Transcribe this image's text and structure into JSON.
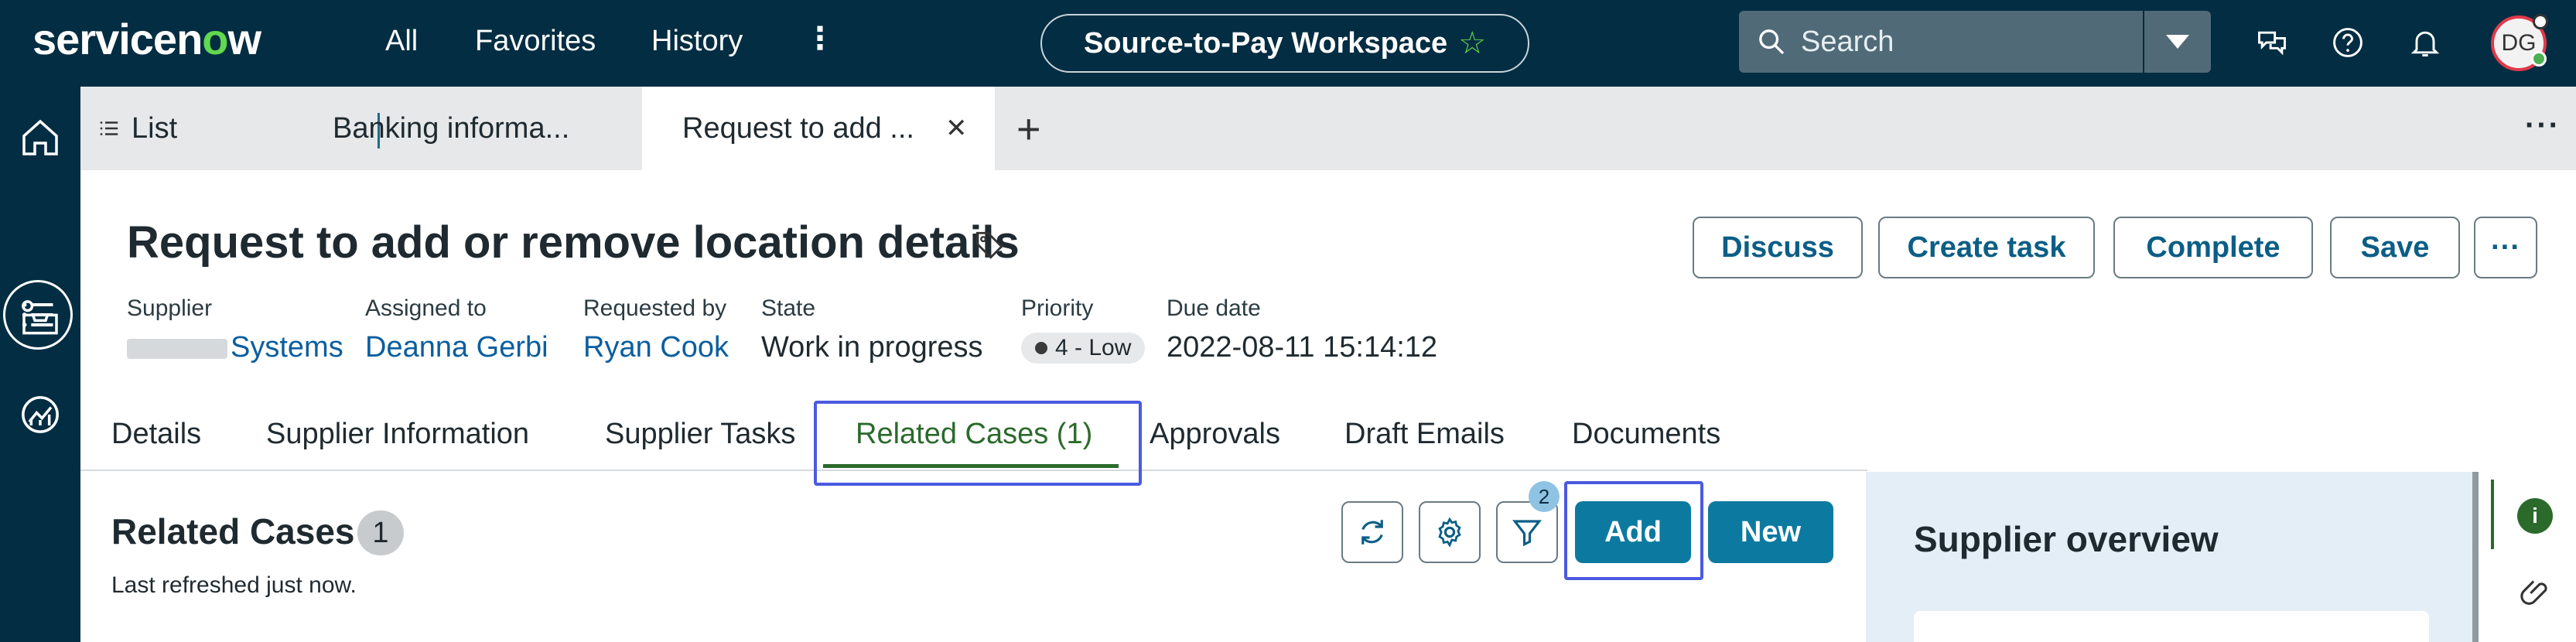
{
  "topbar": {
    "logo": {
      "prefix": "servicen",
      "o": "o",
      "suffix": "w"
    },
    "nav": [
      "All",
      "Favorites",
      "History"
    ],
    "workspace": "Source-to-Pay Workspace",
    "search_placeholder": "Search",
    "avatar_initials": "DG"
  },
  "tabs": {
    "list_label": "List",
    "items": [
      {
        "label": "Banking informa..."
      },
      {
        "label": "Request to add ..."
      }
    ]
  },
  "record": {
    "title": "Request to add or remove location details",
    "buttons": {
      "discuss": "Discuss",
      "create_task": "Create task",
      "complete": "Complete",
      "save": "Save",
      "more": "···"
    },
    "fields": {
      "supplier_label": "Supplier",
      "supplier_value": "Systems",
      "assigned_label": "Assigned to",
      "assigned_value": "Deanna Gerbi",
      "requested_label": "Requested by",
      "requested_value": "Ryan Cook",
      "state_label": "State",
      "state_value": "Work in progress",
      "priority_label": "Priority",
      "priority_value": "4 - Low",
      "due_label": "Due date",
      "due_value": "2022-08-11 15:14:12"
    },
    "tabs": [
      "Details",
      "Supplier Information",
      "Supplier Tasks",
      "Related Cases (1)",
      "Approvals",
      "Draft Emails",
      "Documents"
    ]
  },
  "related_cases": {
    "title": "Related Cases",
    "count": "1",
    "refreshed": "Last refreshed just now.",
    "filter_count": "2",
    "add_label": "Add",
    "new_label": "New"
  },
  "side_panel": {
    "title": "Supplier overview",
    "info_glyph": "i"
  },
  "colors": {
    "nav_bg": "#032d42",
    "accent_green": "#62d84e",
    "primary_button": "#0c7aa0",
    "active_tab": "#2b6a2b",
    "highlight": "#4b5ae0"
  }
}
